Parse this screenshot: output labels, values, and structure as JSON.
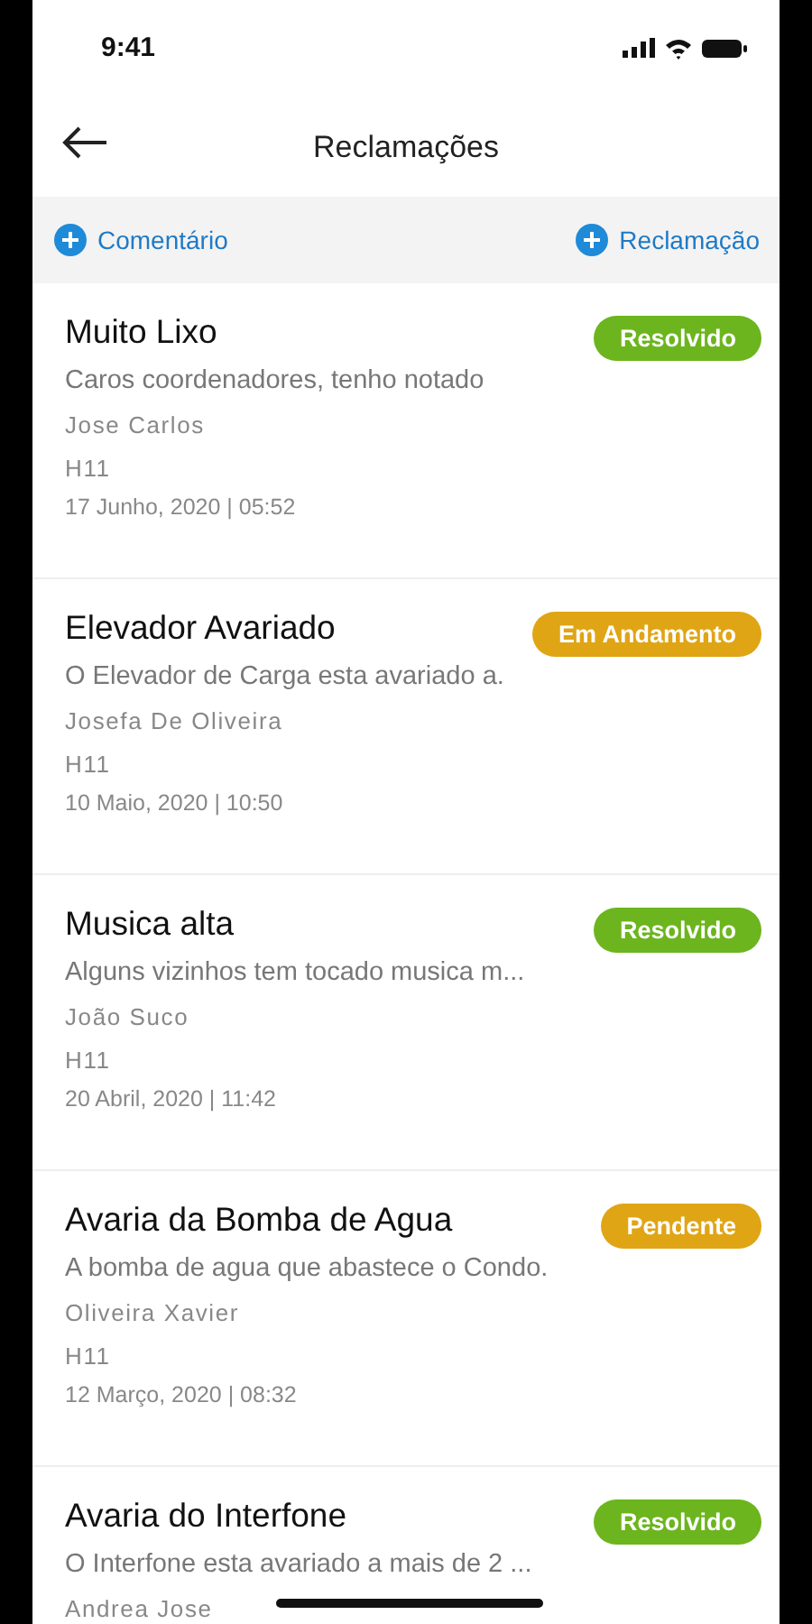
{
  "status_bar": {
    "time": "9:41"
  },
  "header": {
    "title": "Reclamações"
  },
  "actions": [
    {
      "label": "Comentário"
    },
    {
      "label": "Reclamação"
    }
  ],
  "complaints": [
    {
      "title": "Muito Lixo",
      "status": "Resolvido",
      "color": "#6cb51e",
      "description": "Caros coordenadores, tenho notado",
      "author": "Jose Carlos",
      "unit": "H11",
      "date": "17 Junho, 2020 | 05:52"
    },
    {
      "title": "Elevador Avariado",
      "status": "Em Andamento",
      "color": "#e0a515",
      "description": "O Elevador de Carga esta avariado a.",
      "author": "Josefa De Oliveira",
      "unit": "H11",
      "date": "10 Maio, 2020 | 10:50"
    },
    {
      "title": "Musica alta",
      "status": "Resolvido",
      "color": "#6cb51e",
      "description": "Alguns vizinhos tem tocado musica m...",
      "author": "João Suco",
      "unit": "H11",
      "date": "20 Abril, 2020 | 11:42"
    },
    {
      "title": "Avaria da Bomba de Agua",
      "status": "Pendente",
      "color": "#e0a515",
      "description": "A bomba de agua que abastece o Condo.",
      "author": "Oliveira Xavier",
      "unit": "H11",
      "date": "12 Março, 2020 | 08:32"
    },
    {
      "title": "Avaria do Interfone",
      "status": "Resolvido",
      "color": "#6cb51e",
      "description": "O Interfone esta avariado a mais de 2 ...",
      "author": "Andrea Jose"
    }
  ]
}
